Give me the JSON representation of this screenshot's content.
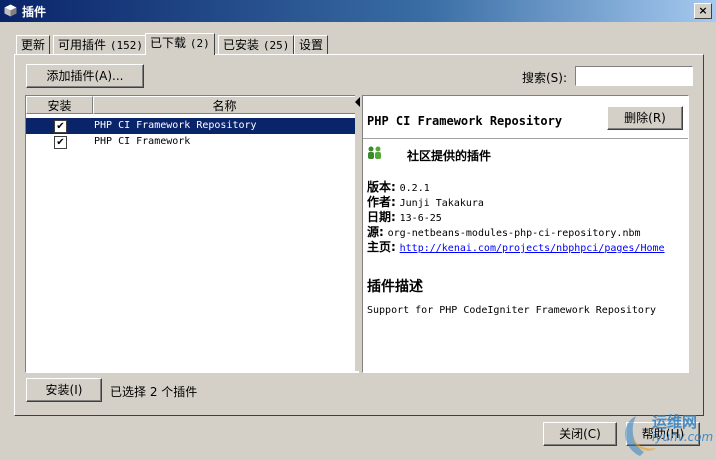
{
  "window": {
    "title": "插件",
    "close_label": "×"
  },
  "tabs": [
    {
      "label": "更新",
      "count": ""
    },
    {
      "label": "可用插件",
      "count": "(152)"
    },
    {
      "label": "已下载",
      "count": "(2)"
    },
    {
      "label": "已安装",
      "count": "(25)"
    },
    {
      "label": "设置",
      "count": ""
    }
  ],
  "active_tab": "已下载",
  "toolbar": {
    "add_plugin_label": "添加插件(A)..."
  },
  "search": {
    "label": "搜索(S):",
    "value": ""
  },
  "table": {
    "columns": [
      "安装",
      "名称"
    ],
    "rows": [
      {
        "checked": true,
        "name": "PHP CI Framework Repository",
        "selected": true
      },
      {
        "checked": true,
        "name": "PHP CI Framework",
        "selected": false
      }
    ],
    "check_glyph": "✔"
  },
  "detail": {
    "title": "PHP CI Framework Repository",
    "delete_label": "删除(R)",
    "category": "社区提供的插件",
    "version_label": "版本:",
    "version": "0.2.1",
    "author_label": "作者:",
    "author": "Junji Takakura",
    "date_label": "日期:",
    "date": "13-6-25",
    "source_label": "源:",
    "source": "org-netbeans-modules-php-ci-repository.nbm",
    "homepage_label": "主页:",
    "homepage": "http://kenai.com/projects/nbphpci/pages/Home",
    "desc_heading": "插件描述",
    "description": "Support for PHP CodeIgniter Framework Repository"
  },
  "footer": {
    "install_label": "安装(I)",
    "status": "已选择 2 个插件",
    "close_label": "关闭(C)",
    "help_label": "帮助(H)"
  },
  "watermark": {
    "line1": "运维网",
    "line2": "iyunv.com"
  },
  "colors": {
    "selection": "#0a246a",
    "titlebar": "#0a246a",
    "link": "#0000ff"
  }
}
